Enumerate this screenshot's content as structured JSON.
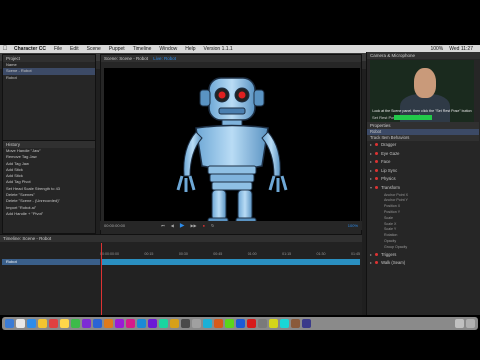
{
  "menubar": {
    "apple": "",
    "items": [
      "Character CC",
      "File",
      "Edit",
      "Scene",
      "Puppet",
      "Timeline",
      "Window",
      "Help",
      "Version 1.1.1"
    ],
    "status_right": [
      "100%",
      "Wed 11:27"
    ]
  },
  "window": {
    "title": "Character Animator Project 2 - Adobe Character Animator CC 2016"
  },
  "modes": [
    {
      "label": "Rig"
    },
    {
      "label": "Record",
      "active": true
    },
    {
      "label": "Stream"
    }
  ],
  "project_panel": {
    "title": "Project",
    "column": "Name",
    "items": [
      "Scene - Robot",
      "Robot"
    ]
  },
  "scene_panel": {
    "title": "Scene: Scene - Robot",
    "tab_hint": "Live: Robot"
  },
  "history_panel": {
    "title": "History",
    "items": [
      "Move Handle \"Jaw\"",
      "Remove Tag Jaw",
      "Add Tag Jaw",
      "Add Stick",
      "Add Stick",
      "Add Tag Pivot",
      "Set Head Scale Strength to 43",
      "Delete \"Scenes\"",
      "Delete \"Scene - (Unrecorded)\"",
      "Import \"Robot.ai\"",
      "Add Handle + \"Pivot\""
    ]
  },
  "transport": {
    "timecode": "00:00:00:00",
    "zoom": "100%"
  },
  "timeline_panel": {
    "title": "Timeline: Scene - Robot",
    "ruler": [
      "00:00:00:00",
      "00:15",
      "00:30",
      "00:45",
      "01:00",
      "01:15",
      "01:30",
      "01:45"
    ],
    "track_name": "Robot"
  },
  "camera_panel": {
    "title": "Camera & Microphone",
    "caption": "Look at the Scene panel, then click the \"Set Rest Pose\" button above",
    "rest_pose": "Set Rest Pose"
  },
  "properties_panel": {
    "title": "Properties",
    "header": "Robot",
    "section": "Track Item Behaviors",
    "behaviors": [
      "Dragger",
      "Eye Gaze",
      "Face",
      "Lip Sync",
      "Physics",
      "Transform"
    ],
    "params": [
      "Anchor Point X",
      "Anchor Point Y",
      "Position X",
      "Position Y",
      "Scale",
      "Scale X",
      "Scale Y",
      "Rotation",
      "Opacity",
      "Group Opacity"
    ],
    "trailing": [
      "Triggers",
      "Walk (Seam)"
    ]
  },
  "colors": {
    "accent": "#2d8ceb",
    "track": "#2a8fc0",
    "level": "#22c94a",
    "playhead": "#dd3333"
  }
}
